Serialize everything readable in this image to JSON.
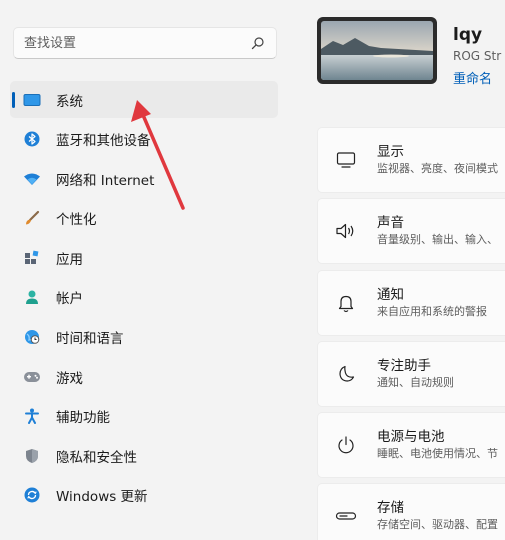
{
  "search": {
    "placeholder": "查找设置"
  },
  "sidebar": {
    "items": [
      {
        "label": "系统"
      },
      {
        "label": "蓝牙和其他设备"
      },
      {
        "label": "网络和 Internet"
      },
      {
        "label": "个性化"
      },
      {
        "label": "应用"
      },
      {
        "label": "帐户"
      },
      {
        "label": "时间和语言"
      },
      {
        "label": "游戏"
      },
      {
        "label": "辅助功能"
      },
      {
        "label": "隐私和安全性"
      },
      {
        "label": "Windows 更新"
      }
    ]
  },
  "profile": {
    "name": "lqy",
    "device": "ROG Str",
    "rename_label": "重命名"
  },
  "main": {
    "cards": [
      {
        "title": "显示",
        "subtitle": "监视器、亮度、夜间模式"
      },
      {
        "title": "声音",
        "subtitle": "音量级别、输出、输入、"
      },
      {
        "title": "通知",
        "subtitle": "来自应用和系统的警报"
      },
      {
        "title": "专注助手",
        "subtitle": "通知、自动规则"
      },
      {
        "title": "电源与电池",
        "subtitle": "睡眠、电池使用情况、节"
      },
      {
        "title": "存储",
        "subtitle": "存储空间、驱动器、配置"
      }
    ]
  },
  "colors": {
    "accent": "#005fb8",
    "annotation_arrow": "#e0383e"
  }
}
